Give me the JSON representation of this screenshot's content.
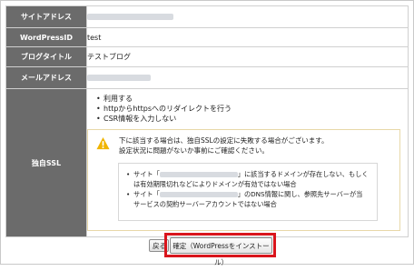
{
  "form": {
    "site_address_label": "サイトアドレス",
    "wordpress_id_label": "WordPressID",
    "wordpress_id_value": "test",
    "blog_title_label": "ブログタイトル",
    "blog_title_value": "テストブログ",
    "email_label": "メールアドレス",
    "ssl_label": "独自SSL",
    "ssl_options": [
      "利用する",
      "httpからhttpsへのリダイレクトを行う",
      "CSR情報を入力しない"
    ]
  },
  "warning": {
    "line1": "下に該当する場合は、独自SSLの設定に失敗する場合がございます。",
    "line2": "設定状況に問題がないか事前にご確認ください。",
    "item1_prefix": "サイト「",
    "item1_suffix": "」に該当するドメインが存在しない、もしく",
    "item1_line2": "は有効期限切れなどによりドメインが有効ではない場合",
    "item2_prefix": "サイト「",
    "item2_suffix": "」のDNS情報に関し、参照先サーバーが当",
    "item2_line2": "サービスの契約サーバーアカウントではない場合"
  },
  "buttons": {
    "back_label": "戻る",
    "confirm_label": "確定（WordPressをインストール）"
  },
  "colors": {
    "label_bg": "#6b6b6b",
    "highlight": "#d9151c",
    "warning_icon": "#f0b400"
  }
}
